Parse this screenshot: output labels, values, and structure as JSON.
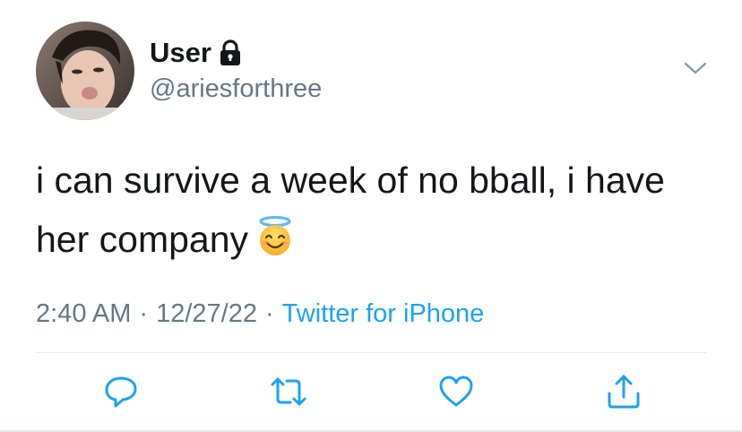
{
  "user": {
    "display_name": "User",
    "handle": "@ariesforthree",
    "protected_icon": "lock-icon",
    "avatar": "avatar-photo"
  },
  "tweet": {
    "text": "i can survive a week of no bball, i have her company",
    "emoji": "smiling-face-with-halo-emoji",
    "time": "2:40 AM",
    "separator": "·",
    "date": "12/27/22",
    "source": "Twitter for iPhone"
  },
  "menu_icon": "chevron-down-icon",
  "actions": [
    "reply-icon",
    "retweet-icon",
    "like-icon",
    "share-icon"
  ],
  "colors": {
    "text": "#14171a",
    "secondary": "#657786",
    "link": "#1da1f2",
    "divider": "#e1e8ed",
    "icon": "#1da1f2"
  }
}
